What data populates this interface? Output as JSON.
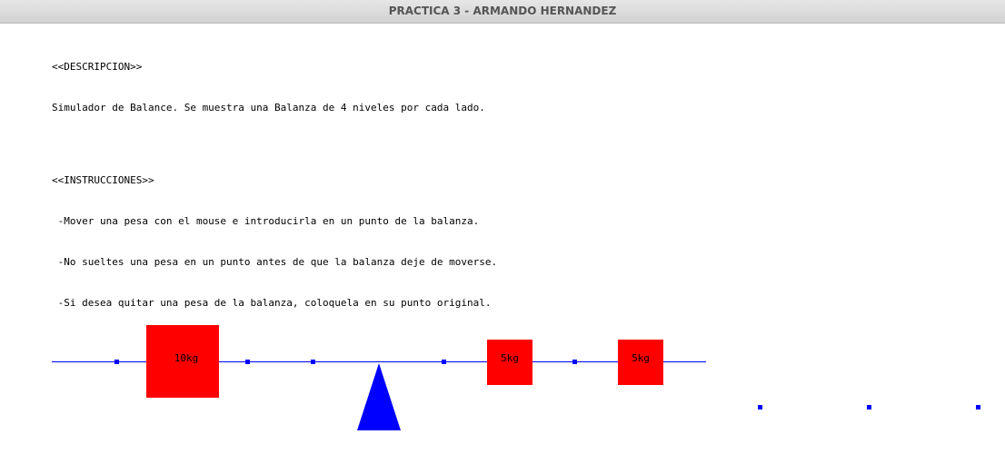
{
  "window": {
    "title": "PRACTICA 3 - ARMANDO HERNANDEZ"
  },
  "description": {
    "heading": "<<DESCRIPCION>>",
    "text": "Simulador de Balance. Se muestra una Balanza de 4 niveles por cada lado."
  },
  "instructions": {
    "heading": "<<INSTRUCCIONES>>",
    "lines": [
      " -Mover una pesa con el mouse e introducirla en un punto de la balanza.",
      " -No sueltes una pesa en un punto antes de que la balanza deje de moverse.",
      " -Si desea quitar una pesa de la balanza, coloquela en su punto original."
    ]
  },
  "weights": {
    "w10": {
      "label": "10kg"
    },
    "w5a": {
      "label": "5kg"
    },
    "w5b": {
      "label": "5kg"
    }
  },
  "colors": {
    "beam": "#0000ff",
    "fulcrum": "#0000ff",
    "weight": "#ff0000",
    "point": "#0000ff"
  }
}
